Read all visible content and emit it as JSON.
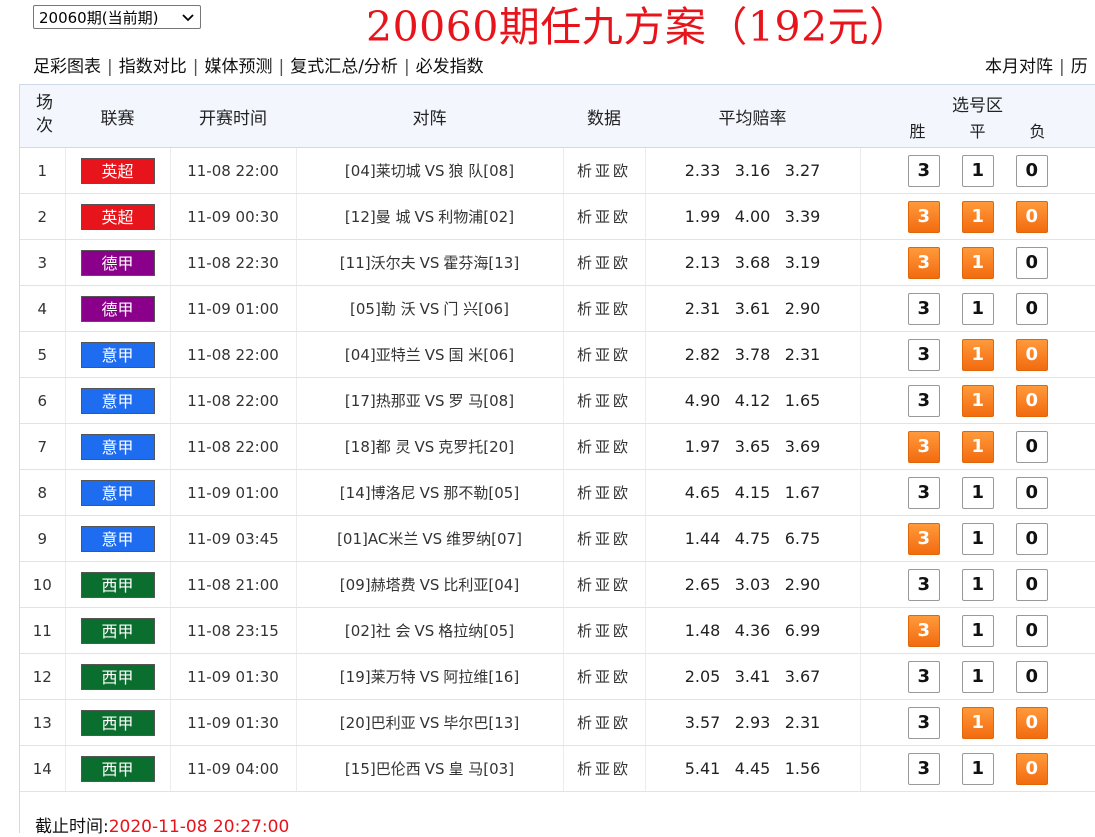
{
  "period_select": {
    "value": "20060期(当前期)"
  },
  "headline": "20060期任九方案（192元）",
  "nav": [
    "足彩图表",
    "指数对比",
    "媒体预测",
    "复式汇总/分析",
    "必发指数"
  ],
  "nav_right": [
    "本月对阵",
    "历"
  ],
  "table": {
    "headers": {
      "index": "场次",
      "league": "联赛",
      "time": "开赛时间",
      "match": "对阵",
      "data": "数据",
      "odds": "平均赔率",
      "select": "选号区"
    },
    "select_sub": [
      "胜",
      "平",
      "负"
    ],
    "rows": [
      {
        "no": "1",
        "league": "英超",
        "color": "#e8141b",
        "time": "11-08 22:00",
        "home": "[04]莱切城",
        "away": "狼 队[08]",
        "data": "析亚欧",
        "odds": [
          "2.33",
          "3.16",
          "3.27"
        ],
        "picks": [
          false,
          false,
          false
        ]
      },
      {
        "no": "2",
        "league": "英超",
        "color": "#e8141b",
        "time": "11-09 00:30",
        "home": "[12]曼 城",
        "away": "利物浦[02]",
        "data": "析亚欧",
        "odds": [
          "1.99",
          "4.00",
          "3.39"
        ],
        "picks": [
          true,
          true,
          true
        ]
      },
      {
        "no": "3",
        "league": "德甲",
        "color": "#8b008b",
        "time": "11-08 22:30",
        "home": "[11]沃尔夫",
        "away": "霍芬海[13]",
        "data": "析亚欧",
        "odds": [
          "2.13",
          "3.68",
          "3.19"
        ],
        "picks": [
          true,
          true,
          false
        ]
      },
      {
        "no": "4",
        "league": "德甲",
        "color": "#8b008b",
        "time": "11-09 01:00",
        "home": "[05]勒 沃",
        "away": "门 兴[06]",
        "data": "析亚欧",
        "odds": [
          "2.31",
          "3.61",
          "2.90"
        ],
        "picks": [
          false,
          false,
          false
        ]
      },
      {
        "no": "5",
        "league": "意甲",
        "color": "#1e6cf0",
        "time": "11-08 22:00",
        "home": "[04]亚特兰",
        "away": "国 米[06]",
        "data": "析亚欧",
        "odds": [
          "2.82",
          "3.78",
          "2.31"
        ],
        "picks": [
          false,
          true,
          true
        ]
      },
      {
        "no": "6",
        "league": "意甲",
        "color": "#1e6cf0",
        "time": "11-08 22:00",
        "home": "[17]热那亚",
        "away": "罗 马[08]",
        "data": "析亚欧",
        "odds": [
          "4.90",
          "4.12",
          "1.65"
        ],
        "picks": [
          false,
          true,
          true
        ]
      },
      {
        "no": "7",
        "league": "意甲",
        "color": "#1e6cf0",
        "time": "11-08 22:00",
        "home": "[18]都 灵",
        "away": "克罗托[20]",
        "data": "析亚欧",
        "odds": [
          "1.97",
          "3.65",
          "3.69"
        ],
        "picks": [
          true,
          true,
          false
        ]
      },
      {
        "no": "8",
        "league": "意甲",
        "color": "#1e6cf0",
        "time": "11-09 01:00",
        "home": "[14]博洛尼",
        "away": "那不勒[05]",
        "data": "析亚欧",
        "odds": [
          "4.65",
          "4.15",
          "1.67"
        ],
        "picks": [
          false,
          false,
          false
        ]
      },
      {
        "no": "9",
        "league": "意甲",
        "color": "#1e6cf0",
        "time": "11-09 03:45",
        "home": "[01]AC米兰",
        "away": "维罗纳[07]",
        "data": "析亚欧",
        "odds": [
          "1.44",
          "4.75",
          "6.75"
        ],
        "picks": [
          true,
          false,
          false
        ]
      },
      {
        "no": "10",
        "league": "西甲",
        "color": "#0a6e2e",
        "time": "11-08 21:00",
        "home": "[09]赫塔费",
        "away": "比利亚[04]",
        "data": "析亚欧",
        "odds": [
          "2.65",
          "3.03",
          "2.90"
        ],
        "picks": [
          false,
          false,
          false
        ]
      },
      {
        "no": "11",
        "league": "西甲",
        "color": "#0a6e2e",
        "time": "11-08 23:15",
        "home": "[02]社 会",
        "away": "格拉纳[05]",
        "data": "析亚欧",
        "odds": [
          "1.48",
          "4.36",
          "6.99"
        ],
        "picks": [
          true,
          false,
          false
        ]
      },
      {
        "no": "12",
        "league": "西甲",
        "color": "#0a6e2e",
        "time": "11-09 01:30",
        "home": "[19]莱万特",
        "away": "阿拉维[16]",
        "data": "析亚欧",
        "odds": [
          "2.05",
          "3.41",
          "3.67"
        ],
        "picks": [
          false,
          false,
          false
        ]
      },
      {
        "no": "13",
        "league": "西甲",
        "color": "#0a6e2e",
        "time": "11-09 01:30",
        "home": "[20]巴利亚",
        "away": "毕尔巴[13]",
        "data": "析亚欧",
        "odds": [
          "3.57",
          "2.93",
          "2.31"
        ],
        "picks": [
          false,
          true,
          true
        ]
      },
      {
        "no": "14",
        "league": "西甲",
        "color": "#0a6e2e",
        "time": "11-09 04:00",
        "home": "[15]巴伦西",
        "away": "皇 马[03]",
        "data": "析亚欧",
        "odds": [
          "5.41",
          "4.45",
          "1.56"
        ],
        "picks": [
          false,
          false,
          true
        ]
      }
    ]
  },
  "pick_labels": [
    "3",
    "1",
    "0"
  ],
  "vs": "VS",
  "deadline": {
    "label": "截止时间:",
    "value": "2020-11-08 20:27:00"
  }
}
